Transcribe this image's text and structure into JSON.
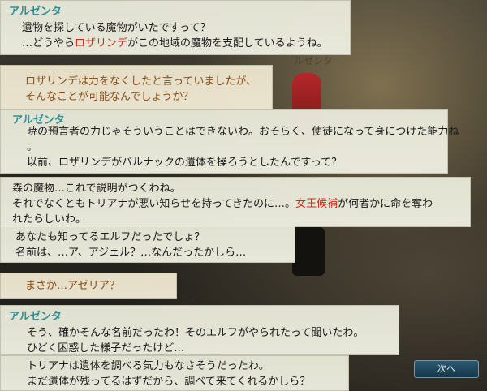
{
  "dialog": [
    {
      "speaker": "アルゼンタ",
      "lines": [
        [
          "遺物を探している魔物がいたですって？"
        ],
        [
          "…どうやら",
          {
            "t": "ロザリンデ",
            "hl": true
          },
          "がこの地域の魔物を支配しているようね。"
        ]
      ]
    },
    {
      "speaker": "",
      "lines": [
        [
          "ロザリンデは力をなくしたと言っていましたが、"
        ],
        [
          "そんなことが可能なんでしょうか？"
        ]
      ]
    },
    {
      "speaker": "アルゼンタ",
      "lines": [
        [
          "暁の預言者の力じゃそういうことはできないわ。おそらく、使徒になって身につけた能力ね"
        ],
        [
          "。"
        ],
        [
          "以前、ロザリンデがバルナックの遺体を操ろうとしたんですって？"
        ]
      ]
    },
    {
      "speaker": "",
      "lines": [
        [
          "森の魔物…これで説明がつくわね。"
        ],
        [
          "それでなくともトリアナが悪い知らせを持ってきたのに…。",
          {
            "t": "女王候補",
            "hl": true
          },
          "が何者かに命を奪わ"
        ],
        [
          "れたらしいわ。"
        ]
      ]
    },
    {
      "speaker": "",
      "lines": [
        [
          "あなたも知ってるエルフだったでしょ？"
        ],
        [
          "名前は、…ア、アジェル？…なんだったかしら…"
        ]
      ]
    },
    {
      "speaker": "",
      "lines": [
        [
          "まさか…アゼリア？"
        ]
      ]
    },
    {
      "speaker": "アルゼンタ",
      "lines": [
        [
          "そう、確かそんな名前だったわ！そのエルフがやられたって聞いたわ。"
        ],
        [
          "ひどく困惑した様子だったけど…"
        ]
      ]
    },
    {
      "speaker": "",
      "lines": [
        [
          "トリアナは遺体を調べる気力もなさそうだったわ。"
        ],
        [
          "まだ遺体が残ってるはずだから、調べて来てくれるかしら？"
        ]
      ]
    }
  ],
  "background_text": {
    "overlay_1": "ルゼンタ",
    "overlay_2": "さそうだったわ"
  },
  "next_button_label": "次へ",
  "colors": {
    "speaker": "#2e8f96",
    "highlight": "#d2261c",
    "player_text": "#8a4f16"
  }
}
